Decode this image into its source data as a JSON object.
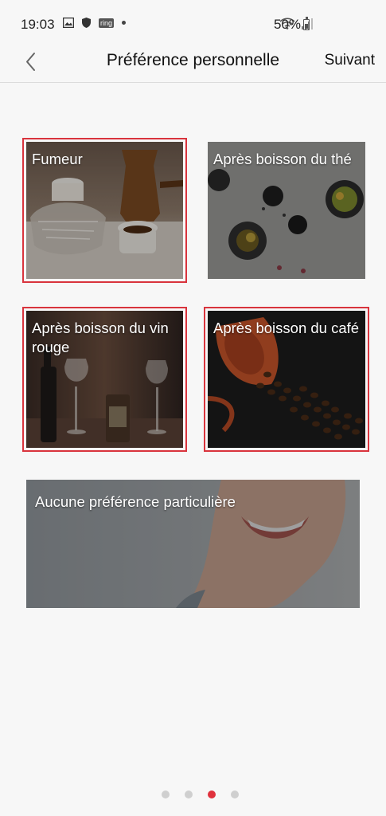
{
  "status_bar": {
    "time": "19:03",
    "notification_icons": [
      "image-icon",
      "shield-icon",
      "ring-icon",
      "dot-icon"
    ],
    "ring_badge": "ring",
    "battery": "50%"
  },
  "header": {
    "title": "Préférence personnelle",
    "next_label": "Suivant"
  },
  "options": {
    "smoker": {
      "label": "Fumeur",
      "selected": true
    },
    "tea": {
      "label": "Après boisson du thé",
      "selected": false
    },
    "wine": {
      "label": "Après boisson du vin rouge",
      "selected": true
    },
    "coffee": {
      "label": "Après boisson du café",
      "selected": true
    },
    "none": {
      "label": "Aucune préférence particulière",
      "selected": false
    }
  },
  "pagination": {
    "total": 4,
    "current": 3
  },
  "colors": {
    "accent": "#d9343d",
    "background": "#f7f7f7"
  }
}
